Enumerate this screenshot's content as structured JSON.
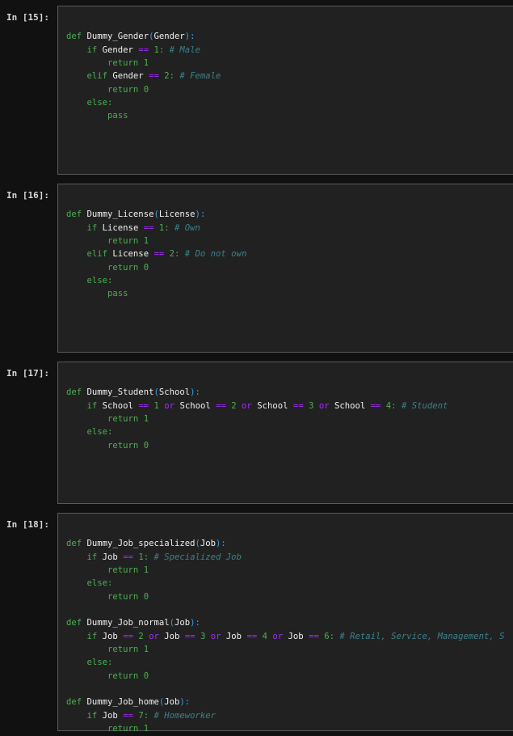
{
  "cells": [
    {
      "prompt": "In [15]:",
      "lines": [
        "",
        "def Dummy_Gender(Gender):",
        "    if Gender == 1: # Male",
        "        return 1",
        "    elif Gender == 2: # Female",
        "        return 0",
        "    else:",
        "        pass"
      ]
    },
    {
      "prompt": "In [16]:",
      "lines": [
        "",
        "def Dummy_License(License):",
        "    if License == 1: # Own",
        "        return 1",
        "    elif License == 2: # Do not own",
        "        return 0",
        "    else:",
        "        pass"
      ]
    },
    {
      "prompt": "In [17]:",
      "lines": [
        "",
        "def Dummy_Student(School):",
        "    if School == 1 or School == 2 or School == 3 or School == 4: # Student",
        "        return 1",
        "    else:",
        "        return 0"
      ]
    },
    {
      "prompt": "In [18]:",
      "lines": [
        "",
        "def Dummy_Job_specialized(Job):",
        "    if Job == 1: # Specialized Job",
        "        return 1",
        "    else:",
        "        return 0",
        "",
        "def Dummy_Job_normal(Job):",
        "    if Job == 2 or Job == 3 or Job == 4 or Job == 6: # Retail, Service, Management, S",
        "        return 1",
        "    else:",
        "        return 0",
        "",
        "def Dummy_Job_home(Job):",
        "    if Job == 7: # Homeworker",
        "        return 1"
      ]
    }
  ]
}
